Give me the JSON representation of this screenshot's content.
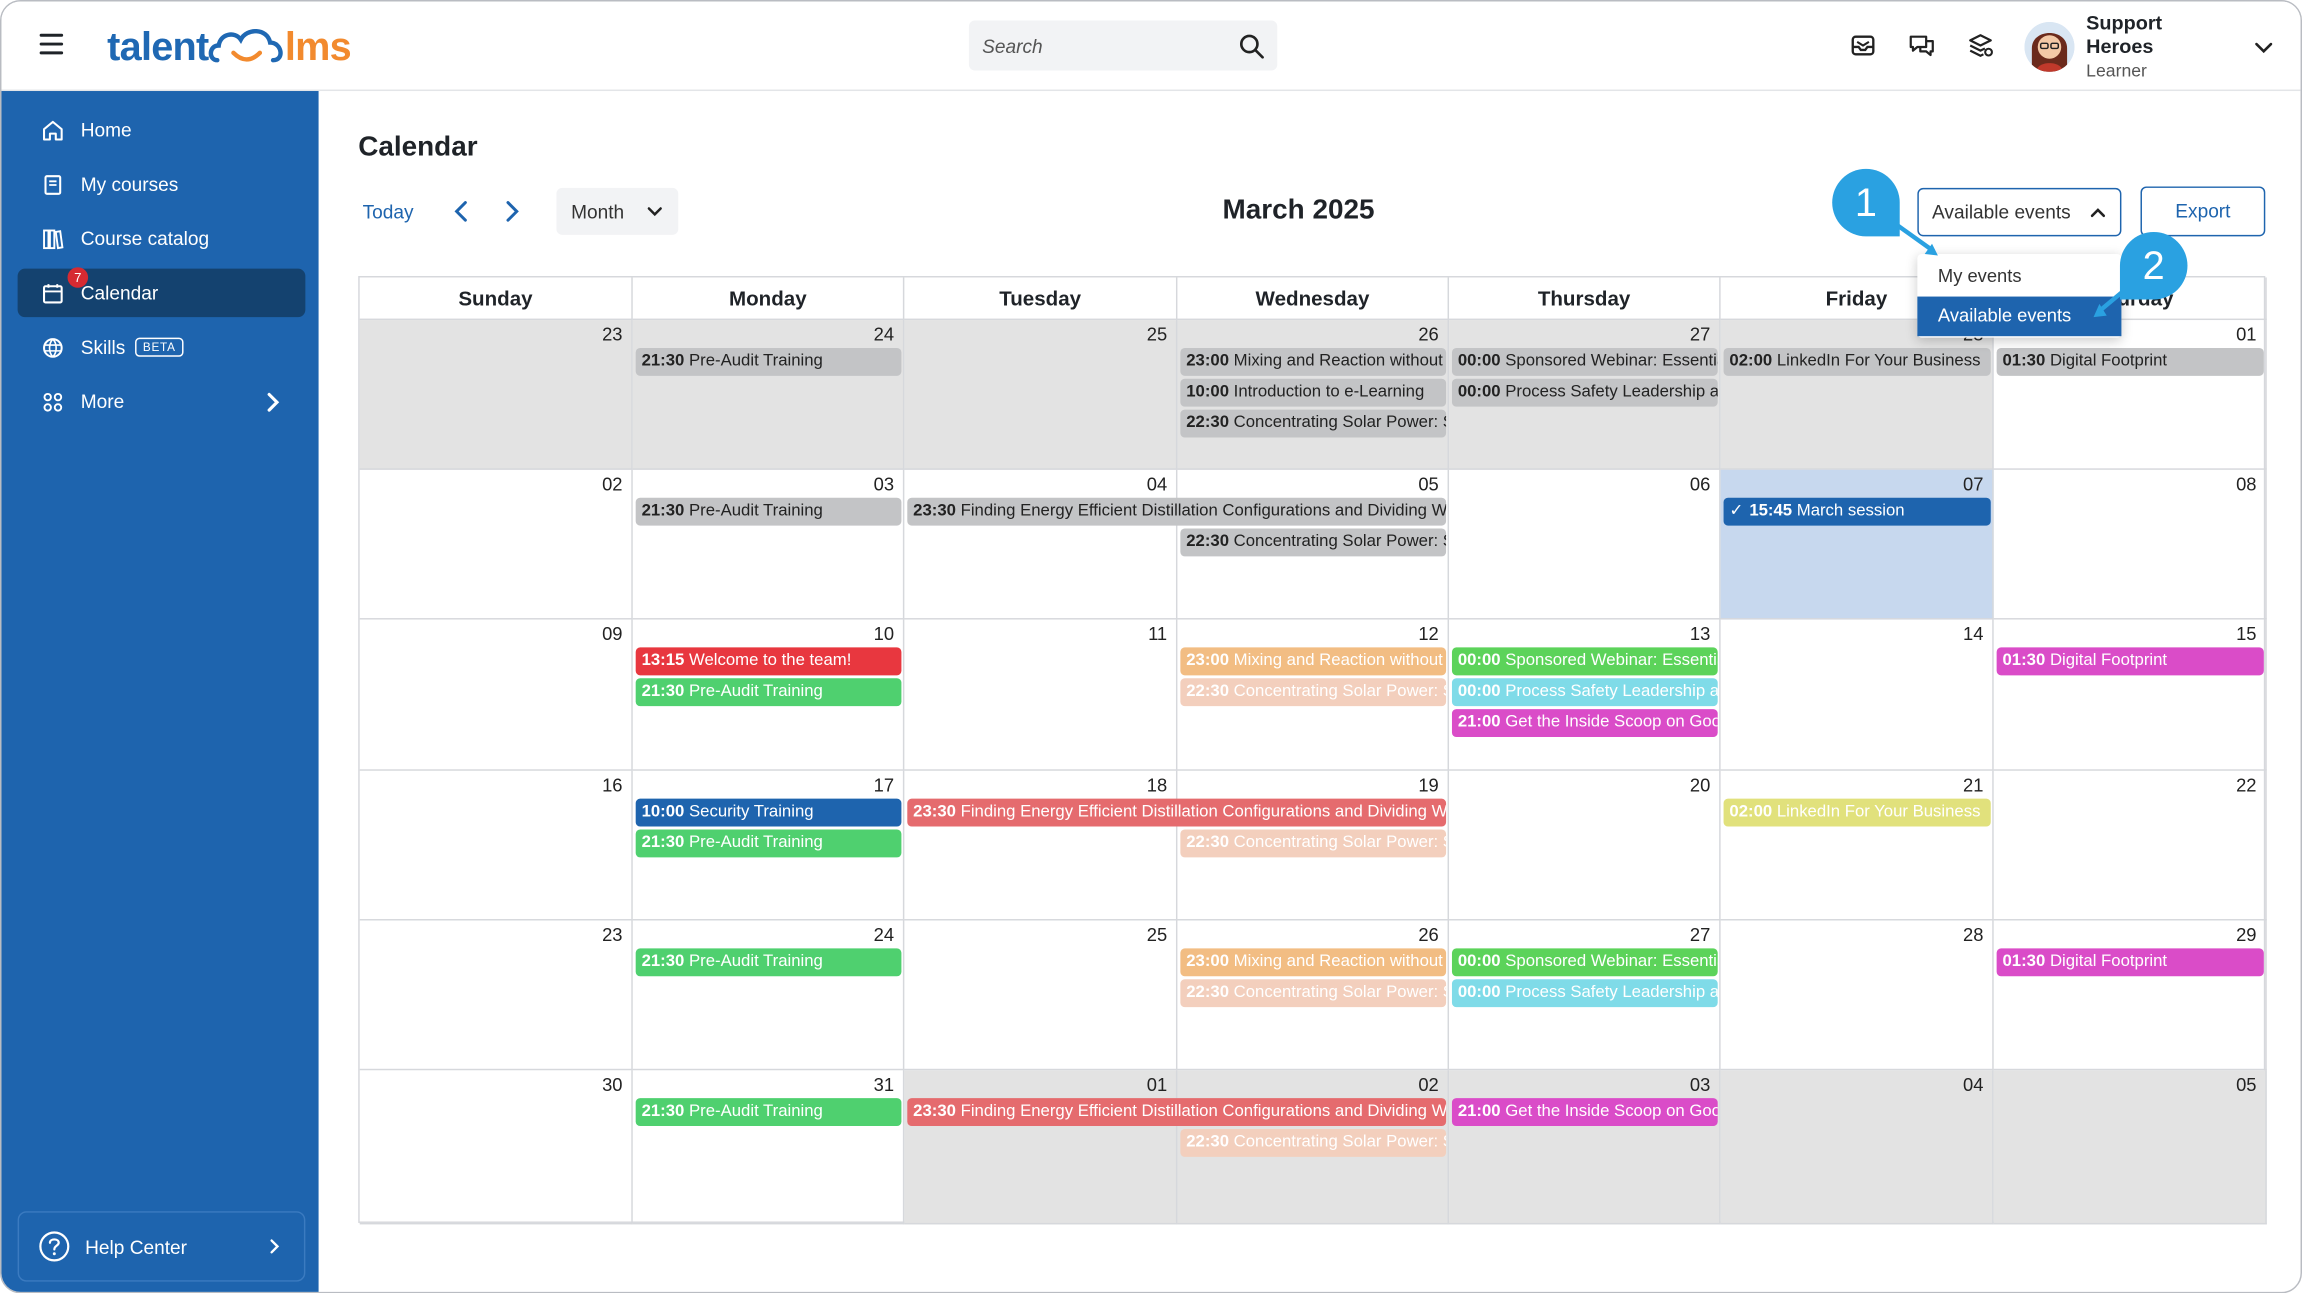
{
  "brand": {
    "part1": "talent",
    "part2": "lms"
  },
  "search": {
    "placeholder": "Search"
  },
  "user": {
    "name": "Support Heroes",
    "role": "Learner"
  },
  "sidebar": {
    "items": [
      {
        "label": "Home",
        "icon": "home-icon"
      },
      {
        "label": "My courses",
        "icon": "book-icon"
      },
      {
        "label": "Course catalog",
        "icon": "catalog-icon"
      },
      {
        "label": "Calendar",
        "icon": "calendar-icon",
        "badge": "7",
        "active": true
      },
      {
        "label": "Skills",
        "icon": "skills-icon",
        "tag": "BETA"
      },
      {
        "label": "More",
        "icon": "grid-icon"
      }
    ],
    "help": "Help Center"
  },
  "calendar": {
    "page_title": "Calendar",
    "today_label": "Today",
    "view": "Month",
    "month_title": "March 2025",
    "events_filter": "Available events",
    "export_label": "Export",
    "dropdown": [
      "My events",
      "Available events"
    ],
    "callouts": [
      "1",
      "2"
    ],
    "weekdays": [
      "Sunday",
      "Monday",
      "Tuesday",
      "Wednesday",
      "Thursday",
      "Friday",
      "Saturday"
    ],
    "weeks": [
      [
        "23",
        "24",
        "25",
        "26",
        "27",
        "28",
        "01"
      ],
      [
        "02",
        "03",
        "04",
        "05",
        "06",
        "07",
        "08"
      ],
      [
        "09",
        "10",
        "11",
        "12",
        "13",
        "14",
        "15"
      ],
      [
        "16",
        "17",
        "18",
        "19",
        "20",
        "21",
        "22"
      ],
      [
        "23",
        "24",
        "25",
        "26",
        "27",
        "28",
        "29"
      ],
      [
        "30",
        "31",
        "01",
        "02",
        "03",
        "04",
        "05"
      ]
    ],
    "events": [
      {
        "w": 0,
        "d": 1,
        "span": 1,
        "slot": 0,
        "time": "21:30",
        "title": "Pre-Audit Training",
        "style": "gray"
      },
      {
        "w": 0,
        "d": 3,
        "span": 1,
        "slot": 0,
        "time": "23:00",
        "title": "Mixing and Reaction without",
        "style": "gray"
      },
      {
        "w": 0,
        "d": 3,
        "span": 1,
        "slot": 1,
        "time": "10:00",
        "title": "Introduction to e-Learning",
        "style": "gray"
      },
      {
        "w": 0,
        "d": 3,
        "span": 1,
        "slot": 2,
        "time": "22:30",
        "title": "Concentrating Solar Power: S",
        "style": "gray"
      },
      {
        "w": 0,
        "d": 4,
        "span": 1,
        "slot": 0,
        "time": "00:00",
        "title": "Sponsored Webinar: Essentia",
        "style": "gray"
      },
      {
        "w": 0,
        "d": 4,
        "span": 1,
        "slot": 1,
        "time": "00:00",
        "title": "Process Safety Leadership an",
        "style": "gray"
      },
      {
        "w": 0,
        "d": 5,
        "span": 1,
        "slot": 0,
        "time": "02:00",
        "title": "LinkedIn For Your Business",
        "style": "gray"
      },
      {
        "w": 0,
        "d": 6,
        "span": 1,
        "slot": 0,
        "time": "01:30",
        "title": "Digital Footprint",
        "style": "gray"
      },
      {
        "w": 1,
        "d": 1,
        "span": 1,
        "slot": 0,
        "time": "21:30",
        "title": "Pre-Audit Training",
        "style": "gray"
      },
      {
        "w": 1,
        "d": 2,
        "span": 2,
        "slot": 0,
        "time": "23:30",
        "title": "Finding Energy Efficient Distillation Configurations and Dividing Wa",
        "style": "gray"
      },
      {
        "w": 1,
        "d": 3,
        "span": 1,
        "slot": 1,
        "time": "22:30",
        "title": "Concentrating Solar Power: S",
        "style": "gray"
      },
      {
        "w": 1,
        "d": 5,
        "span": 1,
        "slot": 0,
        "time": "15:45",
        "title": "March session",
        "style": "navy",
        "check": "✓"
      },
      {
        "w": 2,
        "d": 1,
        "span": 1,
        "slot": 0,
        "time": "13:15",
        "title": "Welcome to the team!",
        "style": "red"
      },
      {
        "w": 2,
        "d": 1,
        "span": 1,
        "slot": 1,
        "time": "21:30",
        "title": "Pre-Audit Training",
        "style": "green"
      },
      {
        "w": 2,
        "d": 3,
        "span": 1,
        "slot": 0,
        "time": "23:00",
        "title": "Mixing and Reaction without",
        "style": "orange"
      },
      {
        "w": 2,
        "d": 3,
        "span": 1,
        "slot": 1,
        "time": "22:30",
        "title": "Concentrating Solar Power: S",
        "style": "peach"
      },
      {
        "w": 2,
        "d": 4,
        "span": 1,
        "slot": 0,
        "time": "00:00",
        "title": "Sponsored Webinar: Essentia",
        "style": "lime"
      },
      {
        "w": 2,
        "d": 4,
        "span": 1,
        "slot": 1,
        "time": "00:00",
        "title": "Process Safety Leadership an",
        "style": "cyan"
      },
      {
        "w": 2,
        "d": 4,
        "span": 1,
        "slot": 2,
        "time": "21:00",
        "title": "Get the Inside Scoop on Goog",
        "style": "magenta"
      },
      {
        "w": 2,
        "d": 6,
        "span": 1,
        "slot": 0,
        "time": "01:30",
        "title": "Digital Footprint",
        "style": "magenta"
      },
      {
        "w": 3,
        "d": 1,
        "span": 1,
        "slot": 0,
        "time": "10:00",
        "title": "Security Training",
        "style": "blue"
      },
      {
        "w": 3,
        "d": 1,
        "span": 1,
        "slot": 1,
        "time": "21:30",
        "title": "Pre-Audit Training",
        "style": "green"
      },
      {
        "w": 3,
        "d": 2,
        "span": 2,
        "slot": 0,
        "time": "23:30",
        "title": "Finding Energy Efficient Distillation Configurations and Dividing Wa",
        "style": "salmon"
      },
      {
        "w": 3,
        "d": 3,
        "span": 1,
        "slot": 1,
        "time": "22:30",
        "title": "Concentrating Solar Power: S",
        "style": "peach"
      },
      {
        "w": 3,
        "d": 5,
        "span": 1,
        "slot": 0,
        "time": "02:00",
        "title": "LinkedIn For Your Business",
        "style": "yellow"
      },
      {
        "w": 4,
        "d": 1,
        "span": 1,
        "slot": 0,
        "time": "21:30",
        "title": "Pre-Audit Training",
        "style": "green"
      },
      {
        "w": 4,
        "d": 3,
        "span": 1,
        "slot": 0,
        "time": "23:00",
        "title": "Mixing and Reaction without",
        "style": "orange"
      },
      {
        "w": 4,
        "d": 3,
        "span": 1,
        "slot": 1,
        "time": "22:30",
        "title": "Concentrating Solar Power: S",
        "style": "peach"
      },
      {
        "w": 4,
        "d": 4,
        "span": 1,
        "slot": 0,
        "time": "00:00",
        "title": "Sponsored Webinar: Essentia",
        "style": "lime"
      },
      {
        "w": 4,
        "d": 4,
        "span": 1,
        "slot": 1,
        "time": "00:00",
        "title": "Process Safety Leadership an",
        "style": "cyan"
      },
      {
        "w": 4,
        "d": 6,
        "span": 1,
        "slot": 0,
        "time": "01:30",
        "title": "Digital Footprint",
        "style": "magenta"
      },
      {
        "w": 5,
        "d": 1,
        "span": 1,
        "slot": 0,
        "time": "21:30",
        "title": "Pre-Audit Training",
        "style": "green"
      },
      {
        "w": 5,
        "d": 2,
        "span": 2,
        "slot": 0,
        "time": "23:30",
        "title": "Finding Energy Efficient Distillation Configurations and Dividing Wa",
        "style": "salmon"
      },
      {
        "w": 5,
        "d": 3,
        "span": 1,
        "slot": 1,
        "time": "22:30",
        "title": "Concentrating Solar Power: S",
        "style": "peach"
      },
      {
        "w": 5,
        "d": 4,
        "span": 1,
        "slot": 0,
        "time": "21:00",
        "title": "Get the Inside Scoop on Goog",
        "style": "magenta"
      }
    ]
  },
  "colors": {
    "brand_blue": "#1e64ae",
    "sidebar_active": "#14426f",
    "brand_orange": "#f28a2e",
    "callout": "#2aa1e1",
    "event_styles": {
      "gray": {
        "bg": "#c3c4c6",
        "fg": "#222222"
      },
      "navy": {
        "bg": "#1e64ae",
        "fg": "#ffffff"
      },
      "blue": {
        "bg": "#1e64ae",
        "fg": "#ffffff"
      },
      "red": {
        "bg": "#e8373f",
        "fg": "#ffffff"
      },
      "green": {
        "bg": "#4fd06f",
        "fg": "#ffffff"
      },
      "orange": {
        "bg": "#f2bd83",
        "fg": "#ffffff"
      },
      "peach": {
        "bg": "#f3cfbd",
        "fg": "#ffffff"
      },
      "lime": {
        "bg": "#5cd35a",
        "fg": "#ffffff"
      },
      "cyan": {
        "bg": "#7fdbe8",
        "fg": "#ffffff"
      },
      "magenta": {
        "bg": "#da4cc8",
        "fg": "#ffffff"
      },
      "salmon": {
        "bg": "#e56b6e",
        "fg": "#ffffff"
      },
      "yellow": {
        "bg": "#e1e17c",
        "fg": "#ffffff"
      }
    }
  }
}
